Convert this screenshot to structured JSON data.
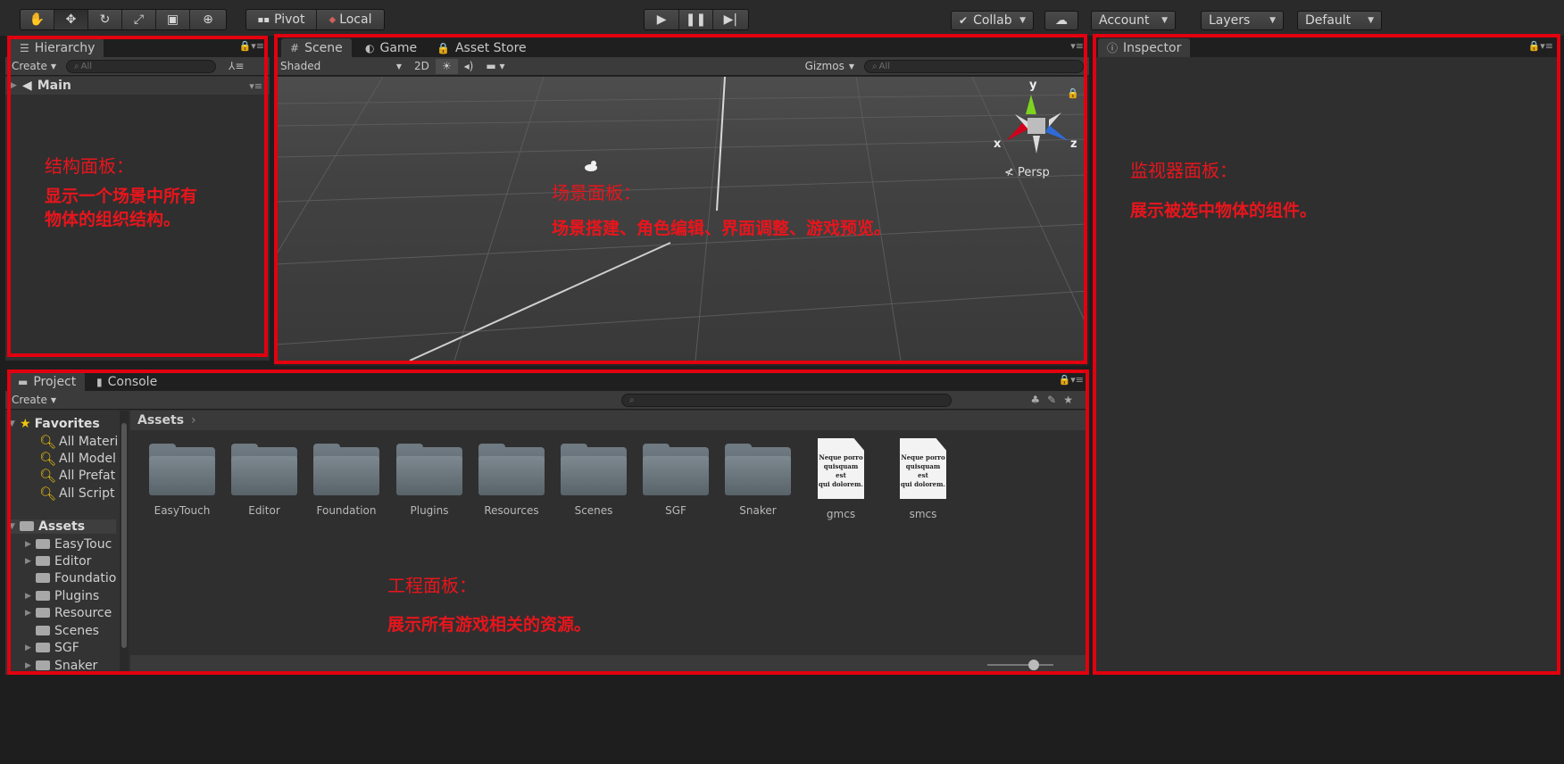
{
  "toolbar": {
    "transform_tools": [
      "hand-icon",
      "move-icon",
      "rotate-icon",
      "scale-icon",
      "rect-icon",
      "transform-icon"
    ],
    "pivot_label": "Pivot",
    "local_label": "Local",
    "play_controls": [
      "play-icon",
      "pause-icon",
      "step-icon"
    ],
    "collab_label": "Collab",
    "account_label": "Account",
    "layers_label": "Layers",
    "layout_label": "Default"
  },
  "hierarchy": {
    "tab": "Hierarchy",
    "create_label": "Create",
    "search_placeholder": "All",
    "scene_name": "Main",
    "annotation_title": "结构面板：",
    "annotation_desc_1": "显示一个场景中所有",
    "annotation_desc_2": "物体的组织结构。"
  },
  "scene": {
    "tabs": [
      "Scene",
      "Game",
      "Asset Store"
    ],
    "shading_mode": "Shaded",
    "mode_2d": "2D",
    "gizmos_label": "Gizmos",
    "search_placeholder": "All",
    "gizmo_axes": {
      "y": "y",
      "x": "x",
      "z": "z"
    },
    "projection": "Persp",
    "annotation_title": "场景面板：",
    "annotation_desc": "场景搭建、角色编辑、界面调整、游戏预览。"
  },
  "inspector": {
    "tab": "Inspector",
    "annotation_title": "监视器面板：",
    "annotation_desc": "展示被选中物体的组件。"
  },
  "project": {
    "tabs": [
      "Project",
      "Console"
    ],
    "create_label": "Create",
    "favorites_label": "Favorites",
    "favorites": [
      "All Materi",
      "All Model",
      "All Prefat",
      "All Script"
    ],
    "assets_label": "Assets",
    "tree": [
      "EasyTouc",
      "Editor",
      "Foundatio",
      "Plugins",
      "Resource",
      "Scenes",
      "SGF",
      "Snaker"
    ],
    "breadcrumb": "Assets",
    "grid_items": [
      {
        "name": "EasyTouch",
        "kind": "folder"
      },
      {
        "name": "Editor",
        "kind": "folder"
      },
      {
        "name": "Foundation",
        "kind": "folder"
      },
      {
        "name": "Plugins",
        "kind": "folder"
      },
      {
        "name": "Resources",
        "kind": "folder"
      },
      {
        "name": "Scenes",
        "kind": "folder"
      },
      {
        "name": "SGF",
        "kind": "folder"
      },
      {
        "name": "Snaker",
        "kind": "folder"
      },
      {
        "name": "gmcs",
        "kind": "text"
      },
      {
        "name": "smcs",
        "kind": "text"
      }
    ],
    "doc_preview_text": [
      "Neque porro",
      "quisquam est",
      "qui dolorem."
    ],
    "annotation_title": "工程面板：",
    "annotation_desc": "展示所有游戏相关的资源。"
  },
  "colors": {
    "annotation_red": "#e2000f",
    "panel_bg": "#2f2f2f",
    "gizmo_y": "#7ed321",
    "gizmo_x": "#d0021b",
    "gizmo_z": "#2f6bd8",
    "favorite_icon": "#f1c40f"
  }
}
